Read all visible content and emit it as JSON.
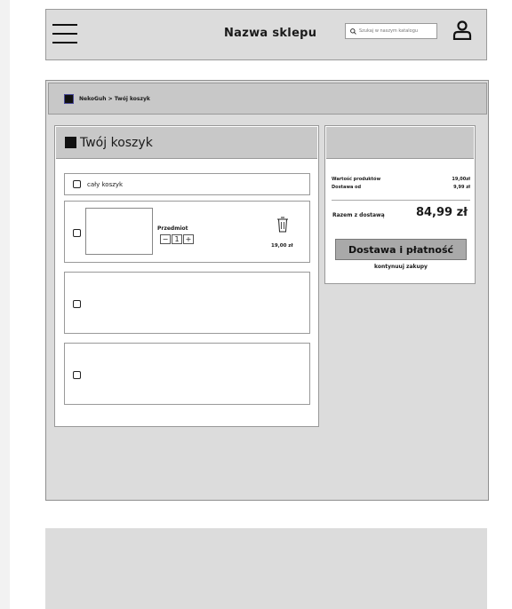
{
  "header": {
    "store_name": "Nazwa sklepu",
    "search_placeholder": "Szukaj w naszym katalogu",
    "icons": [
      "menu-icon",
      "search-icon",
      "user-icon"
    ]
  },
  "breadcrumb": {
    "items": [
      "NekoGuh",
      "Twój koszyk"
    ],
    "separator": ">"
  },
  "cart": {
    "title": "Twój koszyk",
    "select_all_label": "cały koszyk",
    "items": [
      {
        "name": "Przedmiot",
        "quantity": "1",
        "minus": "−",
        "plus": "+",
        "price": "19,00 zł"
      },
      {
        "name": "",
        "quantity": "",
        "price": ""
      },
      {
        "name": "",
        "quantity": "",
        "price": ""
      }
    ]
  },
  "summary": {
    "products_label": "Wartość produktów",
    "products_value": "19,00zł",
    "shipping_label": "Dostawa od",
    "shipping_value": "9,99 zł",
    "total_label": "Razem z dostawą",
    "total_value": "84,99 zł",
    "checkout_button": "Dostawa i płatność",
    "continue_link": "kontynuuj zakupy"
  }
}
